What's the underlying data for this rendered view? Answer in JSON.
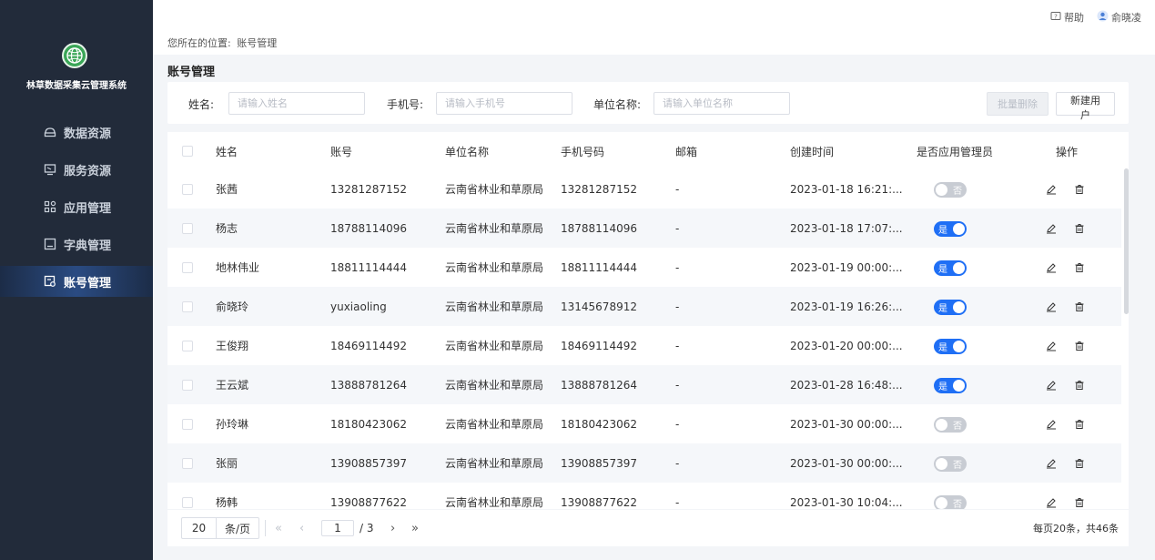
{
  "sidebar": {
    "system_name": "林草数据采集云管理系统",
    "items": [
      {
        "label": "数据资源",
        "icon": "database-icon",
        "active": false
      },
      {
        "label": "服务资源",
        "icon": "service-icon",
        "active": false
      },
      {
        "label": "应用管理",
        "icon": "apps-icon",
        "active": false
      },
      {
        "label": "字典管理",
        "icon": "dictionary-icon",
        "active": false
      },
      {
        "label": "账号管理",
        "icon": "account-icon",
        "active": true
      }
    ]
  },
  "header": {
    "help_label": "帮助",
    "user_name": "俞晓凌"
  },
  "breadcrumb": {
    "prefix": "您所在的位置:",
    "current": "账号管理"
  },
  "page_title": "账号管理",
  "filters": {
    "name_label": "姓名:",
    "name_placeholder": "请输入姓名",
    "phone_label": "手机号:",
    "phone_placeholder": "请输入手机号",
    "org_label": "单位名称:",
    "org_placeholder": "请输入单位名称",
    "batch_delete_label": "批量删除",
    "new_user_label": "新建用户"
  },
  "table": {
    "columns": [
      "姓名",
      "账号",
      "单位名称",
      "手机号码",
      "邮箱",
      "创建时间",
      "是否应用管理员",
      "操作"
    ],
    "rows": [
      {
        "name": "张茜",
        "account": "13281287152",
        "org": "云南省林业和草原局",
        "phone": "13281287152",
        "email": "-",
        "created": "2023-01-18 16:21:...",
        "admin": false,
        "admin_label": "否"
      },
      {
        "name": "杨志",
        "account": "18788114096",
        "org": "云南省林业和草原局",
        "phone": "18788114096",
        "email": "-",
        "created": "2023-01-18 17:07:...",
        "admin": true,
        "admin_label": "是"
      },
      {
        "name": "地林伟业",
        "account": "18811114444",
        "org": "云南省林业和草原局",
        "phone": "18811114444",
        "email": "-",
        "created": "2023-01-19 00:00:...",
        "admin": true,
        "admin_label": "是"
      },
      {
        "name": "俞晓玲",
        "account": "yuxiaoling",
        "org": "云南省林业和草原局",
        "phone": "13145678912",
        "email": "-",
        "created": "2023-01-19 16:26:...",
        "admin": true,
        "admin_label": "是"
      },
      {
        "name": "王俊翔",
        "account": "18469114492",
        "org": "云南省林业和草原局",
        "phone": "18469114492",
        "email": "-",
        "created": "2023-01-20 00:00:...",
        "admin": true,
        "admin_label": "是"
      },
      {
        "name": "王云斌",
        "account": "13888781264",
        "org": "云南省林业和草原局",
        "phone": "13888781264",
        "email": "-",
        "created": "2023-01-28 16:48:...",
        "admin": true,
        "admin_label": "是"
      },
      {
        "name": "孙玲琳",
        "account": "18180423062",
        "org": "云南省林业和草原局",
        "phone": "18180423062",
        "email": "-",
        "created": "2023-01-30 00:00:...",
        "admin": false,
        "admin_label": "否"
      },
      {
        "name": "张丽",
        "account": "13908857397",
        "org": "云南省林业和草原局",
        "phone": "13908857397",
        "email": "-",
        "created": "2023-01-30 00:00:...",
        "admin": false,
        "admin_label": "否"
      },
      {
        "name": "杨韩",
        "account": "13908877622",
        "org": "云南省林业和草原局",
        "phone": "13908877622",
        "email": "-",
        "created": "2023-01-30 10:04:...",
        "admin": false,
        "admin_label": "否"
      }
    ]
  },
  "pagination": {
    "page_size": "20",
    "page_size_unit": "条/页",
    "current_page": "1",
    "total_pages": "/ 3",
    "summary": "每页20条，共46条"
  },
  "colors": {
    "sidebar_bg": "#222b3a",
    "accent": "#1f6ff5",
    "content_bg": "#f3f5f8"
  }
}
